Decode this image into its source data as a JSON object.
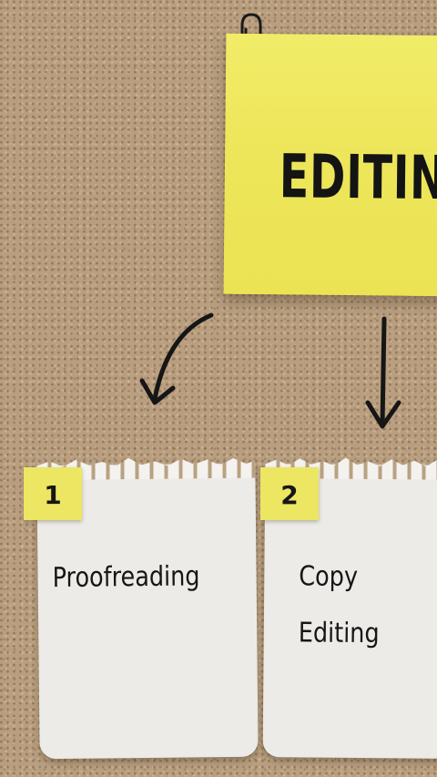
{
  "main_note": {
    "title": "EDITING"
  },
  "steps": [
    {
      "number": "1",
      "lines": [
        "Proofreading"
      ]
    },
    {
      "number": "2",
      "lines": [
        "Copy",
        "Editing"
      ]
    }
  ],
  "colors": {
    "sticky": "#eee65a",
    "paper": "#ecebe8",
    "cork": "#b99f80",
    "ink": "#161616"
  },
  "icons": [
    "paperclip-icon",
    "curved-arrow-icon",
    "down-arrow-icon"
  ]
}
